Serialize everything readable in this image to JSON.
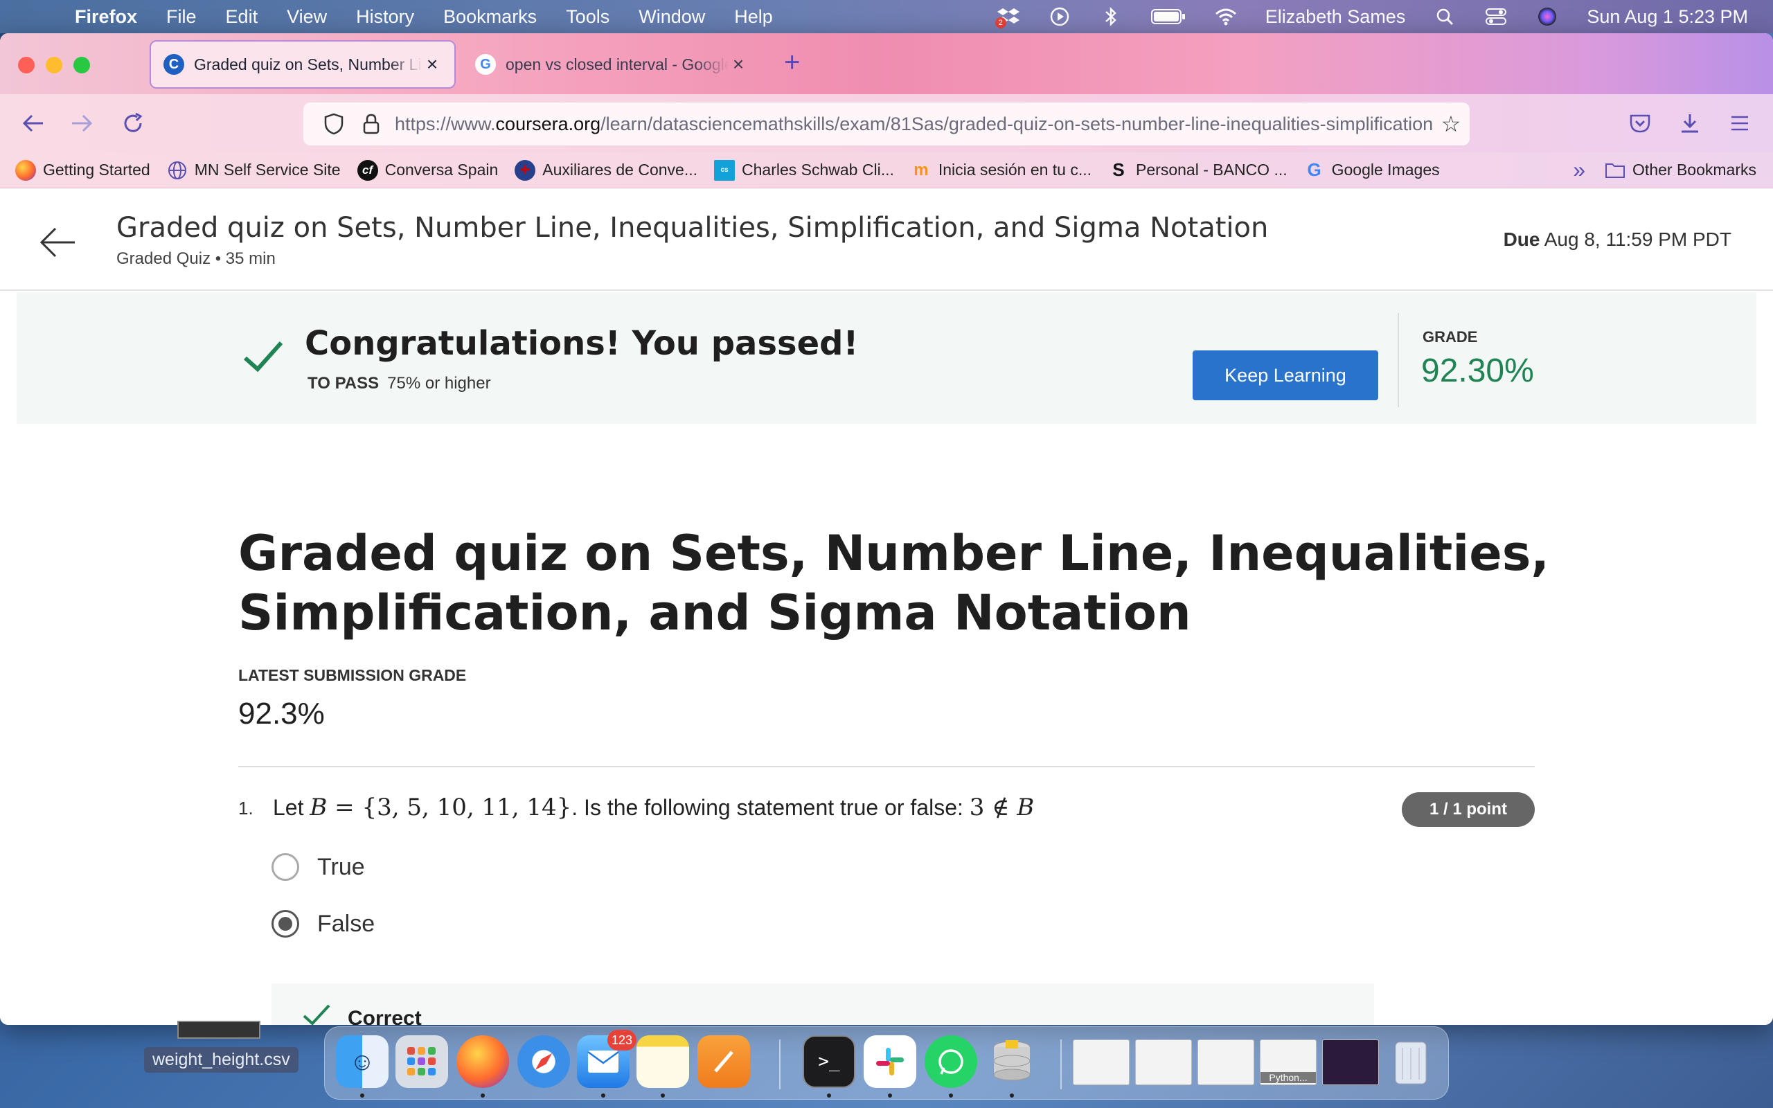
{
  "menubar": {
    "app": "Firefox",
    "items": [
      "File",
      "Edit",
      "View",
      "History",
      "Bookmarks",
      "Tools",
      "Window",
      "Help"
    ],
    "user": "Elizabeth Sames",
    "datetime": "Sun Aug 1  5:23 PM",
    "dropbox_badge": "2"
  },
  "tabs": [
    {
      "label": "Graded quiz on Sets, Number Line, Inequalities, Simplification, and Sigma Notation",
      "favicon": "C"
    },
    {
      "label": "open vs closed interval - Google Search",
      "favicon": "G"
    }
  ],
  "url": {
    "prefix": "https://www.",
    "domain": "coursera.org",
    "path": "/learn/datasciencemathskills/exam/81Sas/graded-quiz-on-sets-number-line-inequalities-simplification-and-sigma-notation"
  },
  "bookmarks": [
    {
      "label": "Getting Started"
    },
    {
      "label": "MN Self Service Site"
    },
    {
      "label": "Conversa Spain"
    },
    {
      "label": "Auxiliares de Conve..."
    },
    {
      "label": "Charles Schwab Cli..."
    },
    {
      "label": "Inicia sesión en tu c..."
    },
    {
      "label": "Personal - BANCO ..."
    },
    {
      "label": "Google Images"
    }
  ],
  "other_bookmarks": "Other Bookmarks",
  "header": {
    "title": "Graded quiz on Sets, Number Line, Inequalities, Simplification, and Sigma Notation",
    "subtitle": "Graded Quiz • 35 min",
    "due_label": "Due",
    "due_value": "Aug 8, 11:59 PM PDT"
  },
  "banner": {
    "title": "Congratulations! You passed!",
    "to_pass_label": "TO PASS",
    "to_pass_value": "75% or higher",
    "button": "Keep Learning",
    "grade_label": "GRADE",
    "grade_value": "92.30%"
  },
  "quiz": {
    "title": "Graded quiz on Sets, Number Line, Inequalities, Simplification, and Sigma Notation",
    "latest_label": "LATEST SUBMISSION GRADE",
    "latest_value": "92.3%"
  },
  "question1": {
    "number": "1.",
    "text_pre": "Let ",
    "set_var": "B",
    "set_eq": " = {3, 5, 10, 11, 14}",
    "text_mid": ". Is the following statement true or false: ",
    "stmt": "3 ∉ ",
    "stmt_var": "B",
    "points": "1 / 1 point",
    "options": [
      {
        "label": "True",
        "selected": false
      },
      {
        "label": "False",
        "selected": true
      }
    ],
    "feedback_label": "Correct"
  },
  "dock": {
    "mail_badge": "123",
    "thumb_label": "Python..."
  },
  "desktop": {
    "file": "weight_height.csv"
  }
}
